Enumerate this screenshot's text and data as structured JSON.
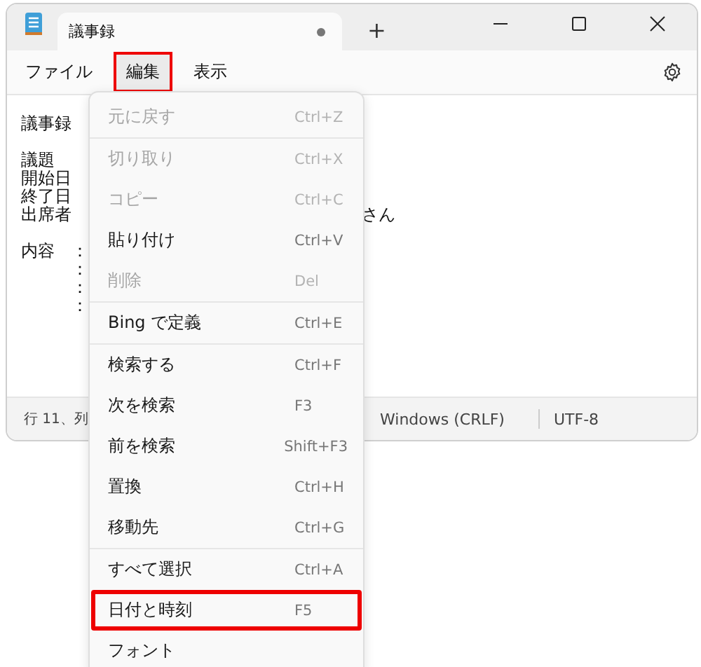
{
  "tab": {
    "title": "議事録",
    "unsaved": true,
    "selected": true
  },
  "new_tab": "+",
  "menu_bar": [
    {
      "label": "ファイル",
      "selected": false,
      "highlighted": false
    },
    {
      "label": "編集",
      "selected": true,
      "highlighted": true
    },
    {
      "label": "表示",
      "selected": false,
      "highlighted": false
    }
  ],
  "editor_paragraphs": [
    [
      {
        "text": "議事録"
      }
    ],
    [
      {
        "text": "議題"
      },
      {
        "text": "開始日"
      },
      {
        "text": "終了日"
      },
      {
        "text": "出席者",
        "right": "さん"
      }
    ],
    [
      {
        "text": "内容　："
      },
      {
        "text": "　　　："
      },
      {
        "text": "　　　："
      },
      {
        "text": "　　　："
      }
    ]
  ],
  "status_bar": {
    "position": "行 11、列",
    "line_ending": "Windows (CRLF)",
    "encoding": "UTF-8"
  },
  "edit_menu": [
    [
      {
        "label": "元に戻す",
        "shortcut": "Ctrl+Z",
        "disabled": true,
        "highlighted": false
      }
    ],
    [
      {
        "label": "切り取り",
        "shortcut": "Ctrl+X",
        "disabled": true,
        "highlighted": false
      },
      {
        "label": "コピー",
        "shortcut": "Ctrl+C",
        "disabled": true,
        "highlighted": false
      },
      {
        "label": "貼り付け",
        "shortcut": "Ctrl+V",
        "disabled": false,
        "highlighted": false
      },
      {
        "label": "削除",
        "shortcut": "Del",
        "disabled": true,
        "highlighted": false
      }
    ],
    [
      {
        "label": "Bing で定義",
        "shortcut": "Ctrl+E",
        "disabled": false,
        "highlighted": false
      }
    ],
    [
      {
        "label": "検索する",
        "shortcut": "Ctrl+F",
        "disabled": false,
        "highlighted": false
      },
      {
        "label": "次を検索",
        "shortcut": "F3",
        "disabled": false,
        "highlighted": false
      },
      {
        "label": "前を検索",
        "shortcut": "Shift+F3",
        "disabled": false,
        "highlighted": false
      },
      {
        "label": "置換",
        "shortcut": "Ctrl+H",
        "disabled": false,
        "highlighted": false
      },
      {
        "label": "移動先",
        "shortcut": "Ctrl+G",
        "disabled": false,
        "highlighted": false
      }
    ],
    [
      {
        "label": "すべて選択",
        "shortcut": "Ctrl+A",
        "disabled": false,
        "highlighted": false
      },
      {
        "label": "日付と時刻",
        "shortcut": "F5",
        "disabled": false,
        "highlighted": true
      },
      {
        "label": "フォント",
        "disabled": false,
        "highlighted": false
      }
    ]
  ]
}
